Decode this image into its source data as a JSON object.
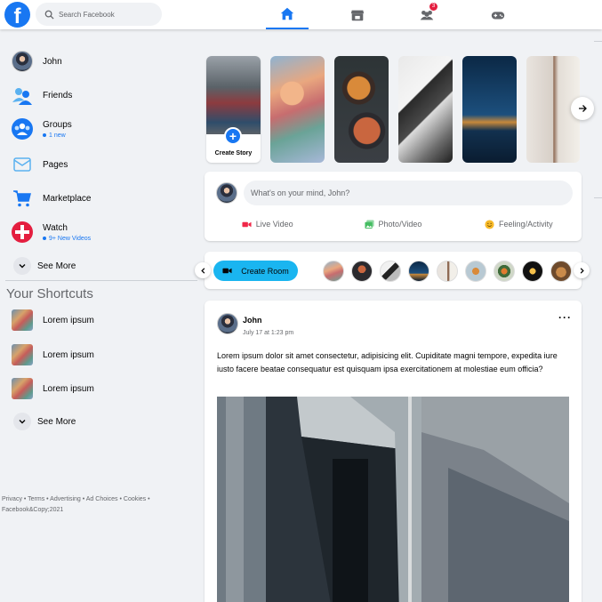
{
  "header": {
    "logo_letter": "f",
    "search_placeholder": "Search Facebook",
    "friends_badge": "3"
  },
  "sidebar": {
    "items": [
      {
        "label": "John",
        "sub": ""
      },
      {
        "label": "Friends",
        "sub": ""
      },
      {
        "label": "Groups",
        "sub": "1 new"
      },
      {
        "label": "Pages",
        "sub": ""
      },
      {
        "label": "Marketplace",
        "sub": ""
      },
      {
        "label": "Watch",
        "sub": "9+ New Videos"
      }
    ],
    "see_more": "See More"
  },
  "shortcuts": {
    "title": "Your Shortcuts",
    "items": [
      "Lorem ipsum",
      "Lorem ipsum",
      "Lorem ipsum"
    ],
    "see_more": "See More"
  },
  "footer": {
    "text": "Privacy • Terms • Advertising • Ad Choices • Cookies • Facebook&Copy;2021"
  },
  "stories": {
    "create_label": "Create Story"
  },
  "composer": {
    "placeholder": "What's on your mind, John?",
    "actions": [
      "Live Video",
      "Photo/Video",
      "Feeling/Activity"
    ]
  },
  "rooms": {
    "button_label": "Create Room"
  },
  "post": {
    "author": "John",
    "time": "July 17 at 1:23 pm",
    "more": "···",
    "text": "Lorem ipsum dolor sit amet consectetur, adipisicing elit. Cupiditate magni tempore, expedita iure iusto facere beatae consequatur est quisquam ipsa exercitationem at molestiae eum officia?"
  },
  "colors": {
    "brand": "#1877f2",
    "room_button": "#1ab5f0",
    "live_video": "#f02849",
    "photo_video": "#45bd62",
    "feeling": "#f7b928"
  }
}
